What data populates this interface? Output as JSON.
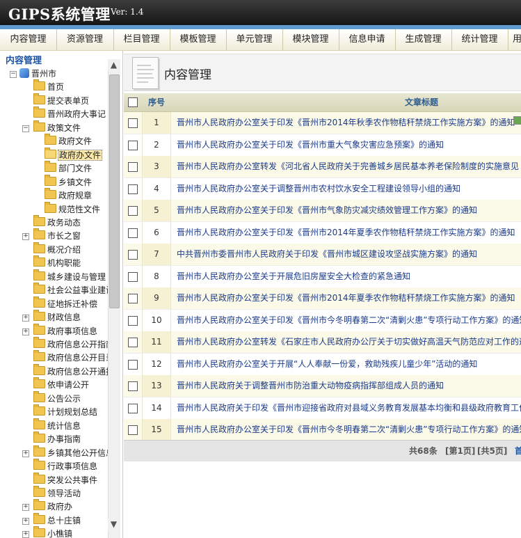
{
  "app": {
    "title": "GIPS系统管理",
    "version": "Ver: 1.4"
  },
  "nav": [
    "内容管理",
    "资源管理",
    "栏目管理",
    "模板管理",
    "单元管理",
    "模块管理",
    "信息申请",
    "生成管理",
    "统计管理",
    "用户"
  ],
  "sidebar": {
    "title": "内容管理",
    "tree": [
      {
        "label": "晋州市",
        "level": 0,
        "expander": "-",
        "icon": "globe"
      },
      {
        "label": "首页",
        "level": 1
      },
      {
        "label": "提交表单页",
        "level": 1
      },
      {
        "label": "晋州政府大事记",
        "level": 1
      },
      {
        "label": "政策文件",
        "level": 1,
        "expander": "-"
      },
      {
        "label": "政府文件",
        "level": 2
      },
      {
        "label": "政府办文件",
        "level": 2,
        "selected": true
      },
      {
        "label": "部门文件",
        "level": 2
      },
      {
        "label": "乡镇文件",
        "level": 2
      },
      {
        "label": "政府规章",
        "level": 2
      },
      {
        "label": "规范性文件",
        "level": 2
      },
      {
        "label": "政务动态",
        "level": 1
      },
      {
        "label": "市长之窗",
        "level": 1,
        "expander": "+"
      },
      {
        "label": "概况介绍",
        "level": 1
      },
      {
        "label": "机构职能",
        "level": 1
      },
      {
        "label": "城乡建设与管理",
        "level": 1
      },
      {
        "label": "社会公益事业建设",
        "level": 1
      },
      {
        "label": "征地拆迁补偿",
        "level": 1
      },
      {
        "label": "财政信息",
        "level": 1,
        "expander": "+"
      },
      {
        "label": "政府事项信息",
        "level": 1,
        "expander": "+"
      },
      {
        "label": "政府信息公开指南",
        "level": 1
      },
      {
        "label": "政府信息公开目录",
        "level": 1
      },
      {
        "label": "政府信息公开通报",
        "level": 1
      },
      {
        "label": "依申请公开",
        "level": 1
      },
      {
        "label": "公告公示",
        "level": 1
      },
      {
        "label": "计划规划总结",
        "level": 1
      },
      {
        "label": "统计信息",
        "level": 1
      },
      {
        "label": "办事指南",
        "level": 1
      },
      {
        "label": "乡镇其他公开信息",
        "level": 1,
        "expander": "+"
      },
      {
        "label": "行政事项信息",
        "level": 1
      },
      {
        "label": "突发公共事件",
        "level": 1
      },
      {
        "label": "领导活动",
        "level": 1
      },
      {
        "label": "政府办",
        "level": 1,
        "expander": "+"
      },
      {
        "label": "总十庄镇",
        "level": 1,
        "expander": "+"
      },
      {
        "label": "小樵镇",
        "level": 1,
        "expander": "+"
      }
    ]
  },
  "main": {
    "title": "内容管理",
    "columns": {
      "index": "序号",
      "title": "文章标题"
    },
    "rows": [
      {
        "index": "1",
        "title": "晋州市人民政府办公室关于印发《晋州市2014年秋季农作物秸秆禁烧工作实施方案》的通知"
      },
      {
        "index": "2",
        "title": "晋州市人民政府办公室关于印发《晋州市重大气象灾害应急预案》的通知"
      },
      {
        "index": "3",
        "title": "晋州市人民政府办公室转发《河北省人民政府关于完善城乡居民基本养老保险制度的实施意见"
      },
      {
        "index": "4",
        "title": "晋州市人民政府办公室关于调整晋州市农村饮水安全工程建设领导小组的通知"
      },
      {
        "index": "5",
        "title": "晋州市人民政府办公室关于印发《晋州市气象防灾减灾绩效管理工作方案》的通知"
      },
      {
        "index": "6",
        "title": "晋州市人民政府办公室关于印发《晋州市2014年夏季农作物秸秆禁烧工作实施方案》的通知"
      },
      {
        "index": "7",
        "title": "中共晋州市委晋州市人民政府关于印发《晋州市城区建设攻坚战实施方案》的通知"
      },
      {
        "index": "8",
        "title": "晋州市人民政府办公室关于开展危旧房屋安全大检查的紧急通知"
      },
      {
        "index": "9",
        "title": "晋州市人民政府办公室关于印发《晋州市2014年夏季农作物秸秆禁烧工作实施方案》的通知"
      },
      {
        "index": "10",
        "title": "晋州市人民政府办公室关于印发《晋州市今冬明春第二次“清剿火患”专项行动工作方案》的通知"
      },
      {
        "index": "11",
        "title": "晋州市人民政府办公室转发《石家庄市人民政府办公厅关于切实做好高温天气防范应对工作的通知"
      },
      {
        "index": "12",
        "title": "晋州市人民政府办公室关于开展“人人奉献一份爱，救助残疾儿童少年”活动的通知"
      },
      {
        "index": "13",
        "title": "晋州市人民政府关于调整晋州市防治重大动物疫病指挥部组成人员的通知"
      },
      {
        "index": "14",
        "title": "晋州市人民政府关于印发《晋州市迎接省政府对县域义务教育发展基本均衡和县级政府教育工作"
      },
      {
        "index": "15",
        "title": "晋州市人民政府办公室关于印发《晋州市今冬明春第二次“清剿火患”专项行动工作方案》的通知"
      }
    ],
    "pager": {
      "total": "共68条",
      "page": "[第1页]",
      "pages": "[共5页]",
      "first": "首"
    }
  },
  "colors": {
    "accent_stripe": "#5f9bd0",
    "header_bg": "#1e1e1e",
    "row_odd": "#fbf9e8",
    "link": "#1a3a8a"
  }
}
